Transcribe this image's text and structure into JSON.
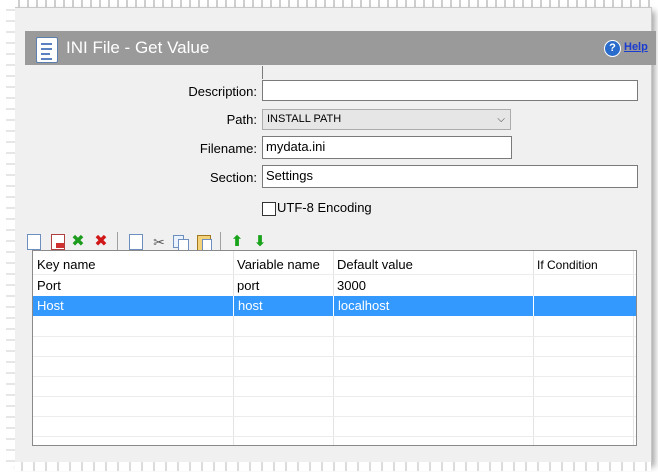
{
  "window": {
    "title": "INI File - Get Value"
  },
  "help": {
    "label": "Help"
  },
  "form": {
    "description_label": "Description:",
    "description_value": "",
    "path_label": "Path:",
    "path_value": "INSTALL PATH",
    "filename_label": "Filename:",
    "filename_value": "mydata.ini",
    "section_label": "Section:",
    "section_value": "Settings",
    "utf8_label": "UTF-8 Encoding",
    "utf8_checked": false
  },
  "toolbar": {
    "icons": [
      "new-item-icon",
      "edit-item-icon",
      "delete-green-icon",
      "delete-red-icon",
      "copy-icon",
      "cut-icon",
      "paste-copy-icon",
      "paste-icon",
      "move-up-icon",
      "move-down-icon"
    ]
  },
  "table": {
    "columns": [
      "Key name",
      "Variable name",
      "Default value",
      "If Condition"
    ],
    "rows": [
      {
        "key": "Port",
        "variable": "port",
        "default": "3000",
        "condition": ""
      },
      {
        "key": "Host",
        "variable": "host",
        "default": "localhost",
        "condition": ""
      }
    ],
    "selected_row": 1
  },
  "colors": {
    "header_bg": "#9a9a9a",
    "selection": "#3399ff",
    "help_link": "#1a3cd0"
  }
}
